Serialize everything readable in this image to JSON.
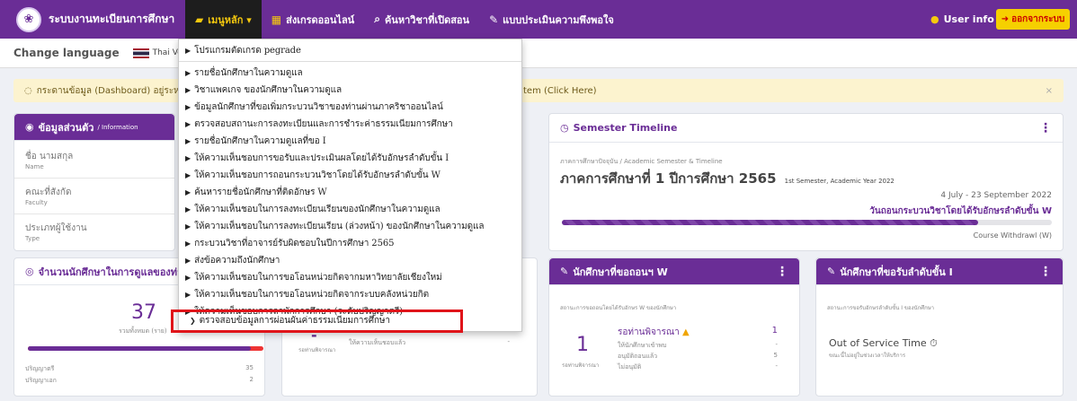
{
  "nav": {
    "brand": "ระบบงานทะเบียนการศึกษา",
    "items": [
      {
        "icon": "folder-icon",
        "label": "เมนูหลัก ▾"
      },
      {
        "icon": "grid-icon",
        "label": "ส่งเกรดออนไลน์"
      },
      {
        "icon": "search-icon",
        "label": "ค้นหาวิชาที่เปิดสอน"
      },
      {
        "icon": "pencil-icon",
        "label": "แบบประเมินความพึงพอใจ"
      }
    ],
    "user": "User info",
    "logout": "ออกจากระบบ"
  },
  "lang": {
    "label": "Change language",
    "tab": "Thai Versi"
  },
  "alert": {
    "text": "กระดานข้อมูล (Dashboard) อยู่ระหว่าง",
    "tail": "tem (Click Here)",
    "close": "×"
  },
  "personal": {
    "title": "ข้อมูลส่วนตัว",
    "sub": "/ Information",
    "fields": [
      {
        "label": "ชื่อ นามสกุล",
        "sub": "Name"
      },
      {
        "label": "คณะที่สังกัด",
        "sub": "Faculty"
      },
      {
        "label": "ประเภทผู้ใช้งาน",
        "sub": "Type"
      }
    ]
  },
  "semester": {
    "title": "Semester Timeline",
    "sub": "ภาคการศึกษาปัจจุบัน / Academic Semester & Timeline",
    "heading": "ภาคการศึกษาที่ 1 ปีการศึกษา 2565",
    "heading_en": "1st Semester, Academic Year 2022",
    "dates": "4 July - 23 September 2022",
    "event": "วันถอนกระบวนวิชาโดยได้รับอักษรลำดับขั้น W",
    "event_en": "Course Withdrawl (W)",
    "progress": 0.85
  },
  "students": {
    "title": "จำนวนนักศึกษาในการดูแลของท่าน",
    "count": "37",
    "count_sub": "รวมทั้งหมด (ราย)",
    "rows": [
      {
        "label": "ปริญญาตรี",
        "value": "35"
      },
      {
        "label": "ปริญญาเอก",
        "value": "2"
      }
    ]
  },
  "withdraw": {
    "title": "นักศึกษาที่ขอถอนฯ W",
    "sub": "สถานะการขอถอนโดยได้รับอักษร W ของนักศึกษา",
    "count": "1",
    "count_sub": "รอท่านพิจารณา",
    "status": "รอท่านพิจารณา",
    "status_value": "1",
    "rows": [
      {
        "label": "ให้นักศึกษาเข้าพบ",
        "value": "-"
      },
      {
        "label": "อนุมัติถอนแล้ว",
        "value": "5"
      },
      {
        "label": "ไม่อนุมัติ",
        "value": "-"
      }
    ]
  },
  "mid": {
    "count": "-",
    "count_sub": "รอท่านพิจารณา",
    "row_label": "ให้ความเห็นชอบแล้ว",
    "row_value": "-"
  },
  "grade_i": {
    "title": "นักศึกษาที่ขอรับลำดับขั้น I",
    "sub": "สถานะการขอรับอักษรลำดับขั้น I ของนักศึกษา",
    "status": "Out of Service Time",
    "status_sub": "ขณะนี้ไม่อยู่ในช่วงเวลาให้บริการ"
  },
  "menu": {
    "items": [
      "โปรแกรมตัดเกรด pegrade",
      "รายชื่อนักศึกษาในความดูแล",
      "วิชาแพคเกจ ของนักศึกษาในความดูแล",
      "ข้อมูลนักศึกษาที่ขอเพิ่มกระบวนวิชาของท่านผ่านภาคริชาออนไลน์",
      "ตรวจสอบสถานะการลงทะเบียนและการชำระค่าธรรมเนียมการศึกษา",
      "รายชื่อนักศึกษาในความดูแลที่ขอ I",
      "ให้ความเห็นชอบการขอรับและประเมินผลโดยได้รับอักษรลำดับขั้น I",
      "ให้ความเห็นชอบการถอนกระบวนวิชาโดยได้รับอักษรลำดับขั้น W",
      "ค้นหารายชื่อนักศึกษาที่ติดอักษร W",
      "ให้ความเห็นชอบในการลงทะเบียนเรียนของนักศึกษาในความดูแล",
      "ให้ความเห็นชอบในการลงทะเบียนเรียน (ล่วงหน้า) ของนักศึกษาในความดูแล",
      "กระบวนวิชาที่อาจารย์รับผิดชอบในปีการศึกษา 2565",
      "ส่งข้อความถึงนักศึกษา",
      "ให้ความเห็นชอบในการขอโอนหน่วยกิตจากมหาวิทยาลัยเชียงใหม่",
      "ให้ความเห็นชอบในการขอโอนหน่วยกิตจากระบบคลังหน่วยกิต",
      "ให้ความเห็นชอบการลาพักการศึกษา (ระดับปริญญาตรี)",
      "ตรวจสอบข้อมูลการผ่อนผันค่าธรรมเนียมการศึกษา"
    ]
  },
  "colors": {
    "brand": "#6a2d96",
    "accent": "#f6c90e",
    "highlight": "#e0141a",
    "progress_fill": "#6a2d96"
  }
}
